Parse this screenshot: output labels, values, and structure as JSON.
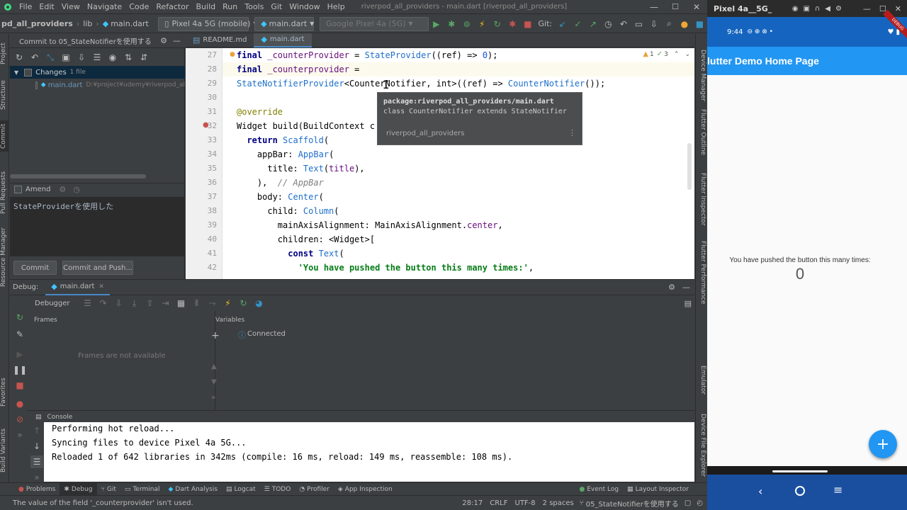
{
  "menu": {
    "items": [
      "File",
      "Edit",
      "View",
      "Navigate",
      "Code",
      "Refactor",
      "Build",
      "Run",
      "Tools",
      "Git",
      "Window",
      "Help"
    ],
    "window_title": "riverpod_all_providers - main.dart [riverpod_all_providers]"
  },
  "navbar": {
    "project": "pd_all_providers",
    "folder": "lib",
    "file": "main.dart",
    "device": "Pixel 4a 5G (mobile)",
    "run_config": "main.dart",
    "target": "Google Pixel 4a (5G)",
    "git_label": "Git:"
  },
  "left_strip": {
    "project": "Project",
    "structure": "Structure",
    "commit": "Commit",
    "pull_requests": "Pull Requests",
    "resource_manager": "Resource Manager",
    "favorites": "Favorites",
    "build_variants": "Build Variants"
  },
  "commit_panel": {
    "title": "Commit to 05_StateNotifierを使用する",
    "changes_label": "Changes",
    "changes_count": "1 file",
    "file_name": "main.dart",
    "file_path": "D:¥project¥udemy¥riverpod_al",
    "amend_label": "Amend",
    "message": "StateProviderを使用した",
    "commit_button": "Commit",
    "commit_push_button": "Commit and Push..."
  },
  "editor_tabs": {
    "readme": "README.md",
    "main": "main.dart"
  },
  "editor": {
    "inspection_warn": "1",
    "inspection_ok": "3",
    "lines": [
      {
        "num": "27",
        "parts": [
          {
            "t": "final ",
            "c": "kw"
          },
          {
            "t": "_counterProvider",
            "c": "fld"
          },
          {
            "t": " = ",
            "c": ""
          },
          {
            "t": "StateProvider",
            "c": "cls"
          },
          {
            "t": "((ref) => ",
            "c": ""
          },
          {
            "t": "0",
            "c": "num"
          },
          {
            "t": ");",
            "c": ""
          }
        ]
      },
      {
        "num": "28",
        "parts": [
          {
            "t": "final ",
            "c": "kw"
          },
          {
            "t": "_counterprovider",
            "c": "fld"
          },
          {
            "t": " =",
            "c": ""
          }
        ]
      },
      {
        "num": "29",
        "parts": [
          {
            "t": "StateNotifierProvider",
            "c": "cls"
          },
          {
            "t": "<CounterNotifier, int>((ref) => ",
            "c": ""
          },
          {
            "t": "CounterNotifier",
            "c": "cls"
          },
          {
            "t": "());",
            "c": ""
          }
        ]
      },
      {
        "num": "30",
        "parts": []
      },
      {
        "num": "31",
        "parts": [
          {
            "t": "@override",
            "c": "ann"
          }
        ]
      },
      {
        "num": "32",
        "parts": [
          {
            "t": "Widget build(BuildContext c",
            "c": ""
          }
        ]
      },
      {
        "num": "33",
        "parts": [
          {
            "t": "  return ",
            "c": "kw"
          },
          {
            "t": "Scaffold",
            "c": "cls"
          },
          {
            "t": "(",
            "c": ""
          }
        ]
      },
      {
        "num": "34",
        "parts": [
          {
            "t": "    appBar: ",
            "c": ""
          },
          {
            "t": "AppBar",
            "c": "cls"
          },
          {
            "t": "(",
            "c": ""
          }
        ]
      },
      {
        "num": "35",
        "parts": [
          {
            "t": "      title: ",
            "c": ""
          },
          {
            "t": "Text",
            "c": "cls"
          },
          {
            "t": "(",
            "c": ""
          },
          {
            "t": "title",
            "c": "fld"
          },
          {
            "t": "),",
            "c": ""
          }
        ]
      },
      {
        "num": "36",
        "parts": [
          {
            "t": "    ),  ",
            "c": ""
          },
          {
            "t": "// AppBar",
            "c": "cmt"
          }
        ]
      },
      {
        "num": "37",
        "parts": [
          {
            "t": "    body: ",
            "c": ""
          },
          {
            "t": "Center",
            "c": "cls"
          },
          {
            "t": "(",
            "c": ""
          }
        ]
      },
      {
        "num": "38",
        "parts": [
          {
            "t": "      child: ",
            "c": ""
          },
          {
            "t": "Column",
            "c": "cls"
          },
          {
            "t": "(",
            "c": ""
          }
        ]
      },
      {
        "num": "39",
        "parts": [
          {
            "t": "        mainAxisAlignment: MainAxisAlignment.",
            "c": ""
          },
          {
            "t": "center",
            "c": "fld"
          },
          {
            "t": ",",
            "c": ""
          }
        ]
      },
      {
        "num": "40",
        "parts": [
          {
            "t": "        children: <Widget>[",
            "c": ""
          }
        ]
      },
      {
        "num": "41",
        "parts": [
          {
            "t": "          const ",
            "c": "kw"
          },
          {
            "t": "Text",
            "c": "cls"
          },
          {
            "t": "(",
            "c": ""
          }
        ]
      },
      {
        "num": "42",
        "parts": [
          {
            "t": "            'You have pushed the button this many times:'",
            "c": "str"
          },
          {
            "t": ",",
            "c": ""
          }
        ]
      }
    ]
  },
  "tooltip": {
    "package": "package:riverpod_all_providers/main.dart",
    "signature": "class CounterNotifier extends StateNotifier",
    "project": "riverpod_all_providers"
  },
  "right_strip": {
    "device_manager": "Device Manager",
    "flutter_outline": "Flutter Outline",
    "flutter_inspector": "Flutter Inspector",
    "flutter_performance": "Flutter Performance",
    "emulator": "Emulator",
    "device_file_explorer": "Device File Explorer"
  },
  "debug": {
    "label": "Debug:",
    "tab": "main.dart",
    "debugger": "Debugger",
    "frames": "Frames",
    "variables": "Variables",
    "frames_empty": "Frames are not available",
    "connected": "Connected",
    "console": "Console",
    "console_lines": [
      "Performing hot reload...",
      "Syncing files to device Pixel 4a 5G...",
      "Reloaded 1 of 642 libraries in 342ms (compile: 16 ms, reload: 149 ms, reassemble: 108 ms)."
    ]
  },
  "bottom_tabs": {
    "left": [
      "Problems",
      "Debug",
      "Git",
      "Terminal",
      "Dart Analysis",
      "Logcat",
      "TODO",
      "Profiler",
      "App Inspection"
    ],
    "right": [
      "Event Log",
      "Layout Inspector"
    ]
  },
  "status": {
    "message": "The value of the field '_counterprovider' isn't used.",
    "position": "28:17",
    "line_sep": "CRLF",
    "encoding": "UTF-8",
    "indent": "2 spaces",
    "branch": "05_StateNotifierを使用する"
  },
  "emulator": {
    "title": "Pixel 4a__5G_",
    "time": "9:44",
    "debug_badge": "DEBUG",
    "app_title": "lutter Demo Home Page",
    "body_text": "You have pushed the button this many times:",
    "counter": "0",
    "fab": "+"
  }
}
